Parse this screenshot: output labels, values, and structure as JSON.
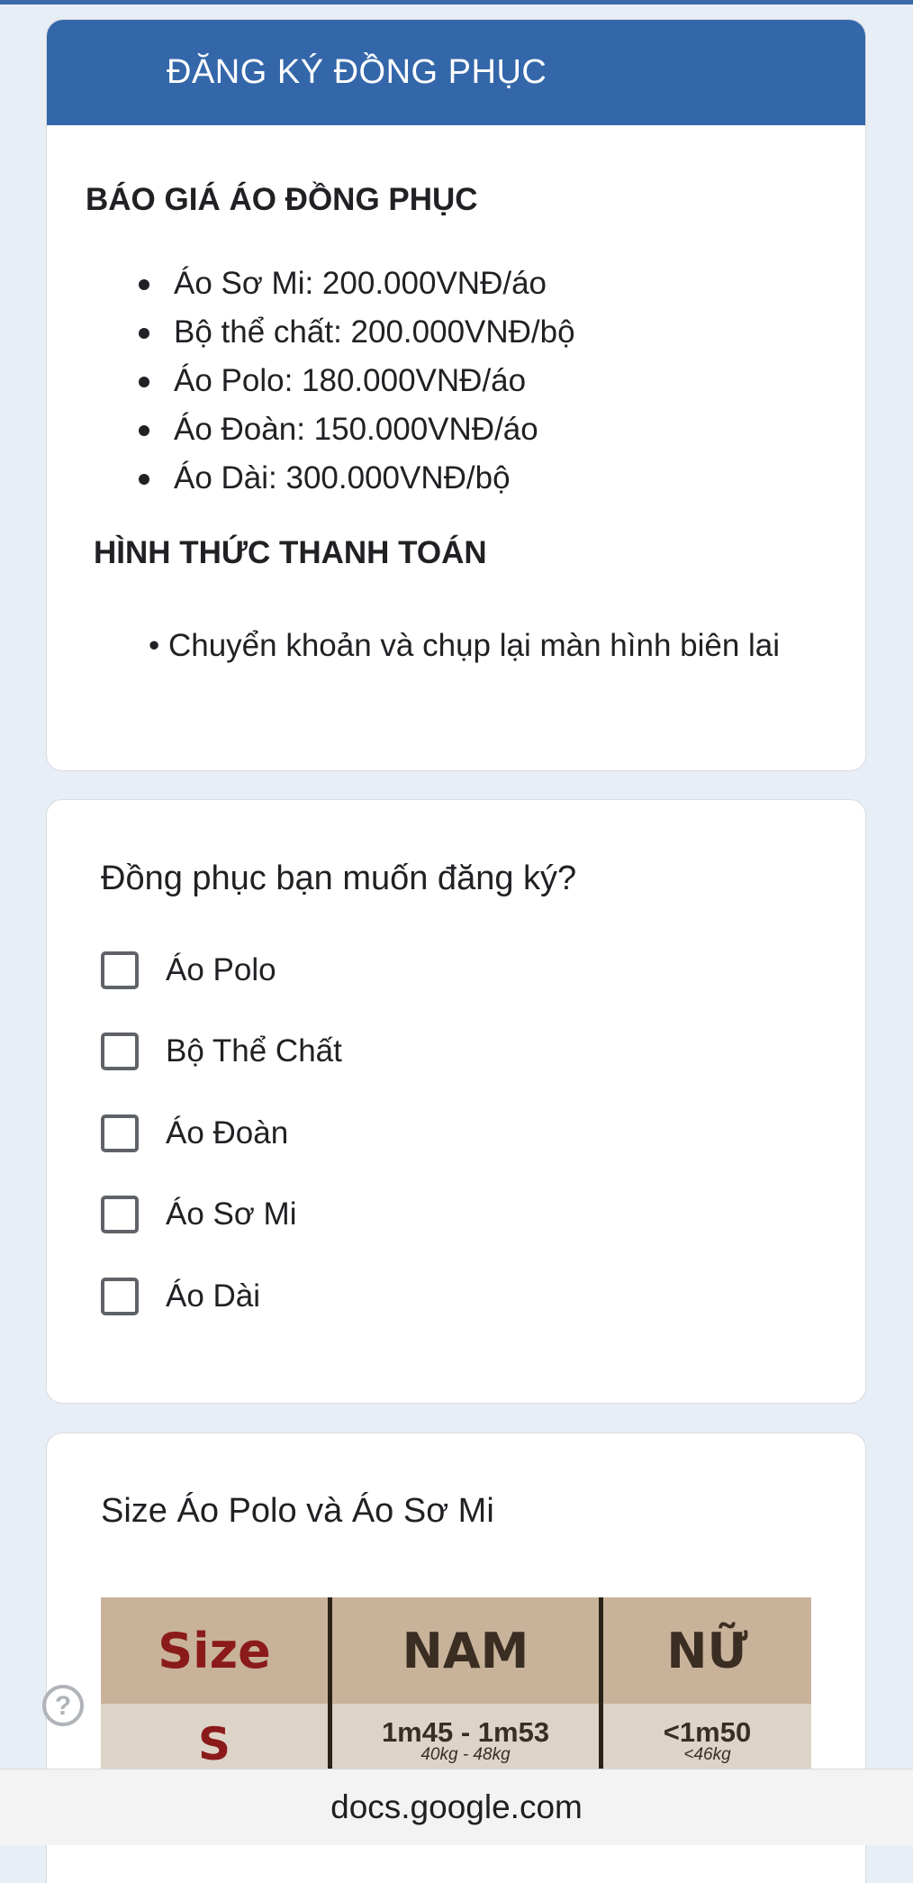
{
  "header": {
    "title": "ĐĂNG KÝ ĐỒNG PHỤC"
  },
  "pricing": {
    "title": "BÁO GIÁ ÁO ĐỒNG PHỤC",
    "items": [
      "Áo Sơ Mi: 200.000VNĐ/áo",
      "Bộ thể chất: 200.000VNĐ/bộ",
      "Áo Polo: 180.000VNĐ/áo",
      "Áo Đoàn: 150.000VNĐ/áo",
      "Áo Dài: 300.000VNĐ/bộ"
    ]
  },
  "payment": {
    "title": "HÌNH THỨC THANH TOÁN",
    "item": "• Chuyển khoản và chụp lại màn hình biên lai"
  },
  "question_uniform": {
    "title": "Đồng phục bạn muốn đăng ký?",
    "options": [
      "Áo Polo",
      "Bộ Thể Chất",
      "Áo Đoàn",
      "Áo Sơ Mi",
      "Áo Dài"
    ]
  },
  "question_size": {
    "title": "Size Áo Polo và Áo Sơ Mi",
    "table": {
      "headers": [
        "Size",
        "NAM",
        "NỮ"
      ],
      "row": {
        "size": "S",
        "male_main": "1m45 - 1m53",
        "male_sub": "40kg - 48kg",
        "female_main": "<1m50",
        "female_sub": "<46kg"
      }
    }
  },
  "help": {
    "label": "?"
  },
  "browser": {
    "url": "docs.google.com"
  },
  "colors": {
    "header": "#3467aa",
    "background": "#e8eef6",
    "table_header": "#c8b39a"
  }
}
